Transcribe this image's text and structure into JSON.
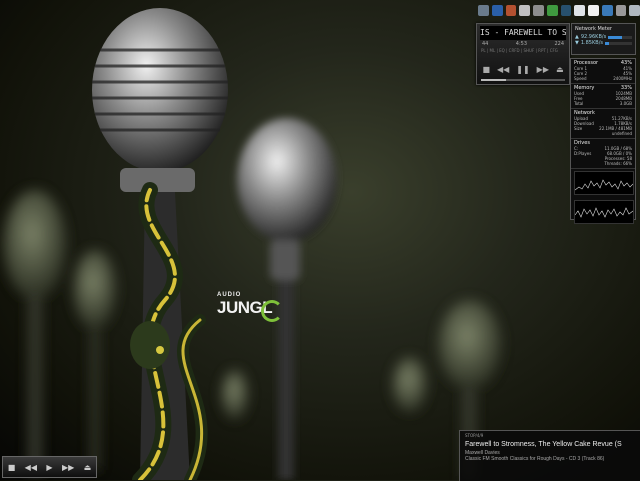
{
  "wallpaper": {
    "logo_small": "AUDIO",
    "logo_big": "JUNGL"
  },
  "quick_launch": [
    {
      "icon": "folder-icon",
      "color": "#6a7b8c"
    },
    {
      "icon": "media-icon",
      "color": "#2a5fa8"
    },
    {
      "icon": "paint-icon",
      "color": "#b35130"
    },
    {
      "icon": "document-icon",
      "color": "#c0c0c0"
    },
    {
      "icon": "mail-icon",
      "color": "#8d8d8d"
    },
    {
      "icon": "home-icon",
      "color": "#3f9a3f"
    },
    {
      "icon": "music-icon",
      "color": "#27506d"
    },
    {
      "icon": "notepad-icon",
      "color": "#dfe3e8"
    },
    {
      "icon": "file-icon",
      "color": "#f2f2f2"
    },
    {
      "icon": "globe-icon",
      "color": "#3a7ab8"
    },
    {
      "icon": "gear-icon",
      "color": "#999999"
    },
    {
      "icon": "recycle-bin-icon",
      "color": "#b0b8c0"
    }
  ],
  "player": {
    "marquee": "IS - FAREWELL TO STROMNESS",
    "kbps_label": "kbps",
    "kbps": "44",
    "time": "4:53",
    "bitrate": "224",
    "modes": "PL | ML | EQ | CRFD | SHUF | RPT | CFG",
    "controls": [
      "stop",
      "previous",
      "pause",
      "next",
      "eject"
    ],
    "progress": 0.3
  },
  "network_meter": {
    "title": "Network Meter",
    "rows": [
      {
        "label": "92.96KB/s",
        "level": 0.6,
        "icon": "up-arrow-icon"
      },
      {
        "label": "1.85KB/s",
        "level": 0.15,
        "icon": "down-arrow-icon"
      }
    ]
  },
  "system_monitor": {
    "processor": {
      "title": "Processor",
      "value": "43%",
      "rows": [
        [
          "Core 1",
          "41%"
        ],
        [
          "Core 2",
          "45%"
        ],
        [
          "Speed",
          "2400MHz"
        ]
      ]
    },
    "memory": {
      "title": "Memory",
      "value": "33%",
      "rows": [
        [
          "Used",
          "1024MB"
        ],
        [
          "Free",
          "2048MB"
        ],
        [
          "Total",
          "3.0GB"
        ]
      ]
    },
    "network": {
      "title": "Network",
      "rows": [
        [
          "Upload",
          "51.27KB/s"
        ],
        [
          "Download",
          "1.78KB/s"
        ],
        [
          "Size",
          "22.1MB / 481MB"
        ]
      ],
      "extra": "undefined"
    },
    "drives": {
      "title": "Drives",
      "rows": [
        [
          "C:",
          "11.0GB / 68%"
        ],
        [
          "D:Playes",
          "68.0GB / 0%"
        ]
      ],
      "footer": [
        "Processes: 58",
        "Threads: 66%"
      ]
    }
  },
  "bottom_player": {
    "controls": [
      "stop",
      "previous",
      "play",
      "next",
      "eject"
    ]
  },
  "now_playing": {
    "label": "STOP/4/9",
    "song": "Farewell to Stromness, The Yellow Cake Revue (S",
    "artist": "Maxwell Davies",
    "album": "Classic FM Smooth Classics for Rough Days - CD 3 (Track 86)"
  }
}
